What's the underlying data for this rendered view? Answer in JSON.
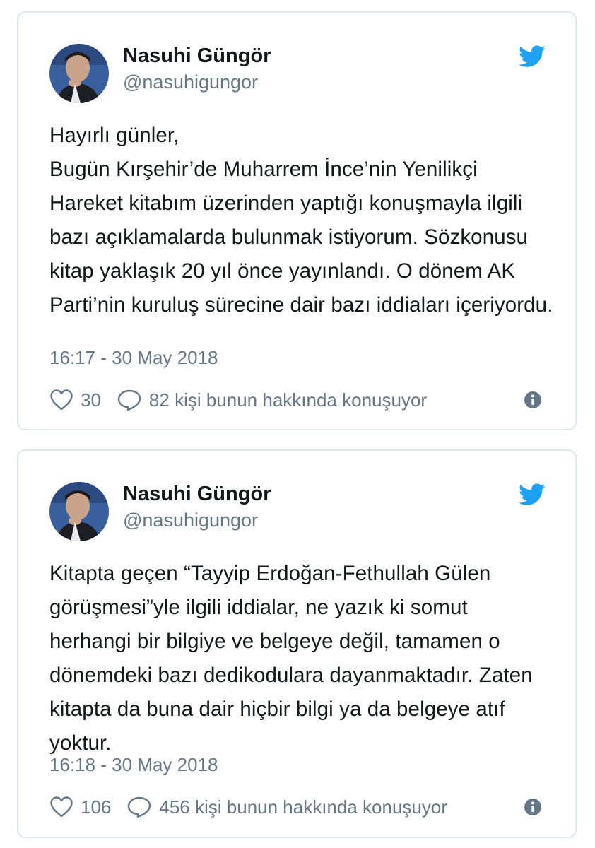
{
  "colors": {
    "twitter_blue": "#1da1f2",
    "text_primary": "#14171a",
    "text_secondary": "#657786",
    "card_border": "#e1e8ed"
  },
  "tweets": [
    {
      "display_name": "Nasuhi Güngör",
      "handle": "@nasuhigungor",
      "text": "Hayırlı günler,\nBugün Kırşehir’de Muharrem İnce’nin Yenilikçi Hareket kitabım üzerinden yaptığı konuşmayla ilgili bazı açıklamalarda bulunmak istiyorum. Sözkonusu kitap yaklaşık 20 yıl önce yayınlandı. O dönem AK Parti’nin kuruluş sürecine dair bazı iddiaları içeriyordu.",
      "timestamp": "16:17 - 30 May 2018",
      "likes": "30",
      "replies_text": "82 kişi bunun hakkında konuşuyor",
      "icons": [
        "avatar",
        "twitter-bird-icon",
        "heart-icon",
        "reply-icon",
        "info-icon"
      ]
    },
    {
      "display_name": "Nasuhi Güngör",
      "handle": "@nasuhigungor",
      "text": "Kitapta geçen “Tayyip Erdoğan-Fethullah Gülen görüşmesi”yle ilgili iddialar, ne yazık ki somut herhangi bir bilgiye ve belgeye değil, tamamen o dönemdeki bazı dedikodulara dayanmaktadır. Zaten kitapta da buna dair hiçbir bilgi ya da belgeye atıf yoktur.",
      "timestamp": "16:18 - 30 May 2018",
      "likes": "106",
      "replies_text": "456 kişi bunun hakkında konuşuyor",
      "icons": [
        "avatar",
        "twitter-bird-icon",
        "heart-icon",
        "reply-icon",
        "info-icon"
      ]
    }
  ]
}
